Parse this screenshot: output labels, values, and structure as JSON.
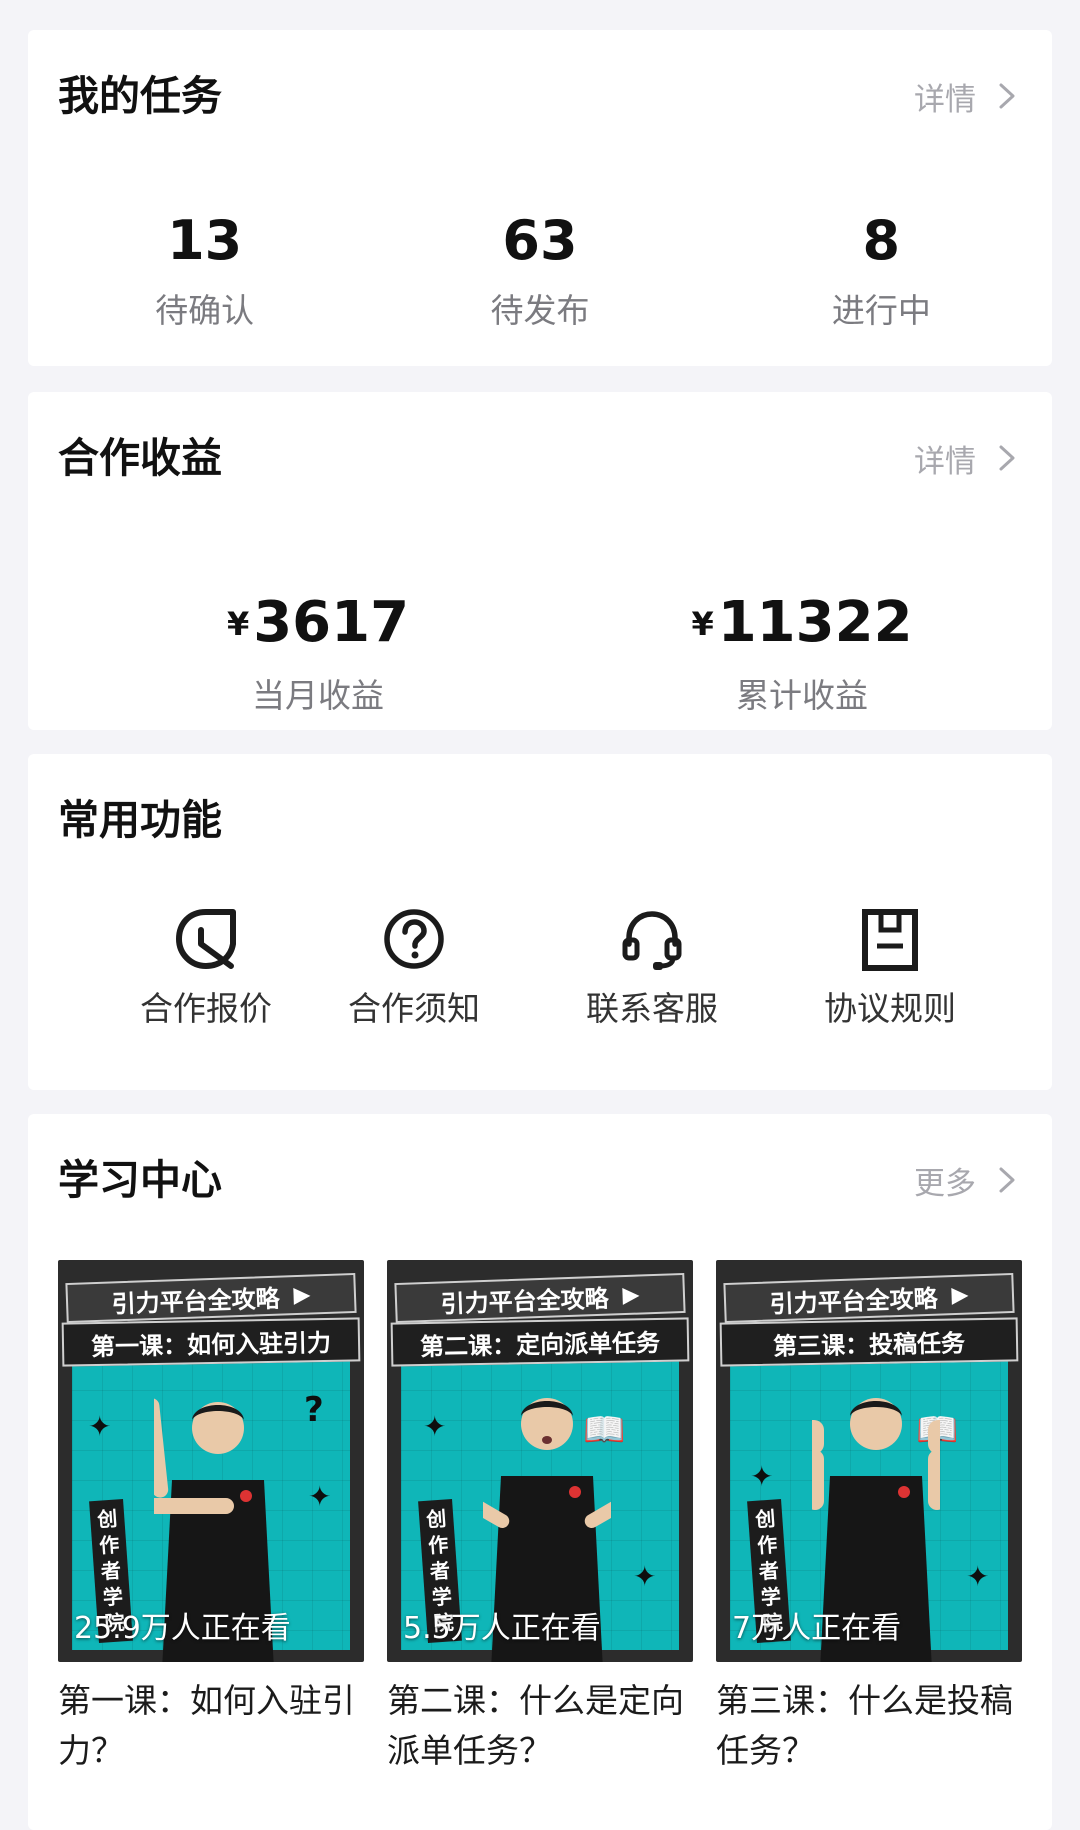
{
  "tasks": {
    "title": "我的任务",
    "link": "详情",
    "stats": [
      {
        "value": "13",
        "label": "待确认"
      },
      {
        "value": "63",
        "label": "待发布"
      },
      {
        "value": "8",
        "label": "进行中"
      }
    ]
  },
  "earnings": {
    "title": "合作收益",
    "link": "详情",
    "currency": "¥",
    "monthly": {
      "value": "3617",
      "label": "当月收益"
    },
    "total": {
      "value": "11322",
      "label": "累计收益"
    }
  },
  "functions": {
    "title": "常用功能",
    "items": [
      {
        "label": "合作报价",
        "icon": "leaf-tag-icon"
      },
      {
        "label": "合作须知",
        "icon": "question-circle-icon"
      },
      {
        "label": "联系客服",
        "icon": "headset-icon"
      },
      {
        "label": "协议规则",
        "icon": "document-icon"
      }
    ]
  },
  "learning": {
    "title": "学习中心",
    "link": "更多",
    "videos": [
      {
        "banner_top": "引力平台全攻略",
        "banner_sub": "第一课：如何入驻引力",
        "side_text": "创作者学院",
        "views": "25.9万人正在看",
        "title": "第一课：如何入驻引力？"
      },
      {
        "banner_top": "引力平台全攻略",
        "banner_sub": "第二课：定向派单任务",
        "side_text": "创作者学院",
        "views": "5.5万人正在看",
        "title": "第二课：什么是定向派单任务？"
      },
      {
        "banner_top": "引力平台全攻略",
        "banner_sub": "第三课：投稿任务",
        "side_text": "创作者学院",
        "views": "7万人正在看",
        "title": "第三课：什么是投稿任务？"
      }
    ]
  },
  "colors": {
    "background": "#f4f4f8",
    "card": "#ffffff",
    "muted_text": "#a8a8ae",
    "thumbnail_teal": "#0fb6b8"
  }
}
